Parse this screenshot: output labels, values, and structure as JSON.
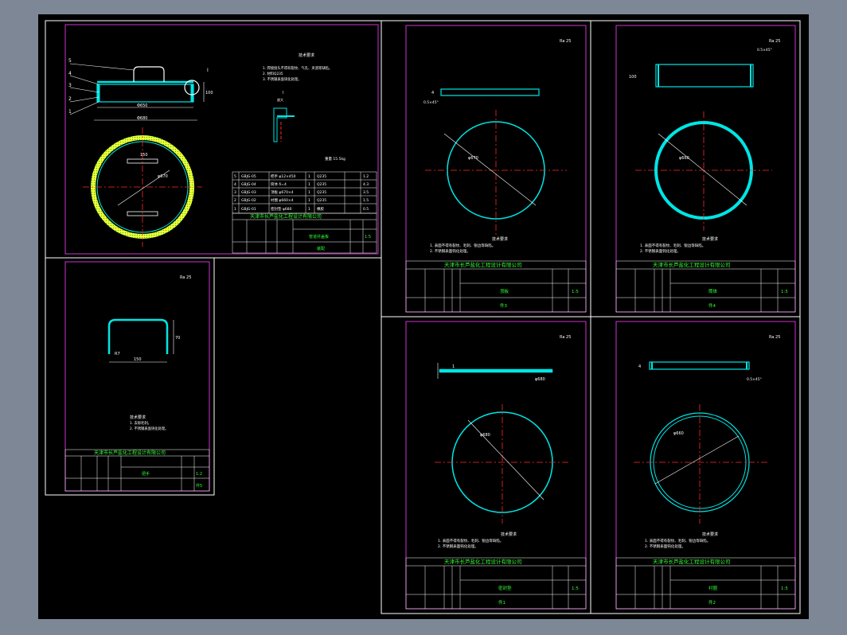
{
  "colors": {
    "background": "#000000",
    "canvas_frame": "#ffffff",
    "sheet_border": "#cc33cc",
    "geometry": "#00e5e5",
    "centerline": "#ff2a2a",
    "annotation": "#ffffff",
    "title_text": "#33ff33",
    "gasket": "#ffff33"
  },
  "sheets": {
    "assembly": {
      "company": "天津市长芦盐化工程设计有限公司",
      "callouts": [
        "5",
        "4",
        "3",
        "2",
        "1"
      ],
      "dimensions": {
        "inner_width": "Φ650",
        "outer_width": "Φ680",
        "height": "100",
        "handle_width": "150",
        "radius": "R5",
        "diameter": "φ670",
        "detail_label": "I"
      },
      "tech_title": "技术要求",
      "tech_notes": [
        "1. 焊接接头不得有裂纹、气孔、夹渣等缺陷。",
        "2. 材料Q235",
        "3. 不锈钢表面钝化处理。"
      ],
      "detail_title": "I",
      "detail_scale": "放大",
      "mass_line": "重量 15.5kg",
      "bom_rows": [
        {
          "no": "5",
          "code": "GBJG-05",
          "name": "把手 φ12×450",
          "qty": "1",
          "mat": "Q235",
          "note": "1.2"
        },
        {
          "no": "4",
          "code": "GBJG-04",
          "name": "筒体 δ=4",
          "qty": "1",
          "mat": "Q235",
          "note": "4.3"
        },
        {
          "no": "3",
          "code": "GBJG-03",
          "name": "顶板 φ670×4",
          "qty": "1",
          "mat": "Q235",
          "note": "3.5"
        },
        {
          "no": "2",
          "code": "GBJG-02",
          "name": "衬圈 φ660×4",
          "qty": "1",
          "mat": "Q235",
          "note": "1.5"
        },
        {
          "no": "1",
          "code": "GBJG-01",
          "name": "密封垫 φ680",
          "qty": "1",
          "mat": "橡胶",
          "note": "0.5"
        }
      ],
      "title_block": {
        "drawing": "管道井盖板",
        "scale": "1:5",
        "sheet": "装配"
      }
    },
    "handle": {
      "company": "天津市长芦盐化工程设计有限公司",
      "roughness": "Ra 25",
      "dims": {
        "width": "150",
        "height": "70",
        "radius": "R7"
      },
      "tech_title": "技术要求",
      "tech_notes": [
        "1. 去除毛刺。",
        "2. 不锈钢表面钝化处理。"
      ],
      "title_block": {
        "drawing": "把手",
        "scale": "1:2",
        "sheet": "件5"
      }
    },
    "top_plate": {
      "company": "天津市长芦盐化工程设计有限公司",
      "roughness": "Ra 25",
      "dims": {
        "thickness": "4",
        "chamfer": "0.5×45°",
        "diameter": "φ670"
      },
      "tech_title": "技术要求",
      "tech_notes": [
        "1. 表面不得有裂纹、毛刺、锐边等缺陷。",
        "2. 不锈钢表面钝化处理。"
      ],
      "title_block": {
        "drawing": "顶板",
        "scale": "1:5",
        "sheet": "件3"
      }
    },
    "shell": {
      "company": "天津市长芦盐化工程设计有限公司",
      "roughness": "Ra 25",
      "dims": {
        "height": "100",
        "chamfer": "0.5×45°",
        "diameter": "φ660"
      },
      "tech_title": "技术要求",
      "tech_notes": [
        "1. 表面不得有裂纹、毛刺、锐边等缺陷。",
        "2. 不锈钢表面钝化处理。"
      ],
      "title_block": {
        "drawing": "筒体",
        "scale": "1:5",
        "sheet": "件4"
      }
    },
    "gasket": {
      "company": "天津市长芦盐化工程设计有限公司",
      "roughness": "Ra 25",
      "dims": {
        "thickness": "1",
        "diameter": "φ680"
      },
      "tech_title": "技术要求",
      "tech_notes": [
        "1. 表面不得有裂纹、毛刺、锐边等缺陷。",
        "2. 不锈钢表面钝化处理。"
      ],
      "title_block": {
        "drawing": "密封垫",
        "scale": "1:5",
        "sheet": "件1"
      }
    },
    "ring": {
      "company": "天津市长芦盐化工程设计有限公司",
      "roughness": "Ra 25",
      "dims": {
        "thickness": "4",
        "chamfer": "0.5×45°",
        "diameter": "φ660"
      },
      "tech_title": "技术要求",
      "tech_notes": [
        "1. 表面不得有裂纹、毛刺、锐边等缺陷。",
        "2. 不锈钢表面钝化处理。"
      ],
      "title_block": {
        "drawing": "衬圈",
        "scale": "1:5",
        "sheet": "件2"
      }
    }
  }
}
